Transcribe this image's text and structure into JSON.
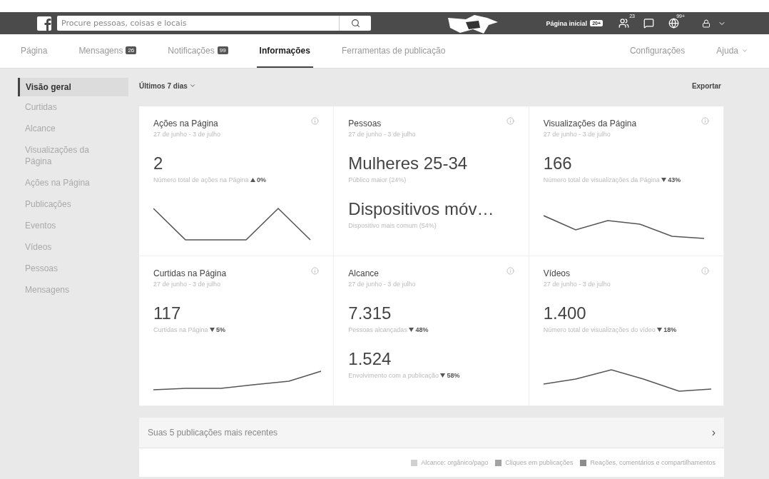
{
  "top_bar": {
    "search": {
      "placeholder": "Procure pessoas, coisas e locais"
    },
    "home": {
      "label": "Página inicial",
      "badge": "20+"
    },
    "friends_badge": "23",
    "globe_badge": "99+"
  },
  "tabs": [
    {
      "label": "Página",
      "selected": false
    },
    {
      "label": "Mensagens",
      "badge": "26",
      "selected": false
    },
    {
      "label": "Notificações",
      "badge": "99",
      "selected": false
    },
    {
      "label": "Informações",
      "selected": true
    },
    {
      "label": "Ferramentas de publicação",
      "selected": false
    }
  ],
  "right_tabs": [
    {
      "label": "Configurações"
    },
    {
      "label": "Ajuda",
      "dropdown": true
    }
  ],
  "sidebar": {
    "items": [
      {
        "label": "Visão geral",
        "selected": true
      },
      {
        "label": "Curtidas",
        "selected": false
      },
      {
        "label": "Alcance",
        "selected": false
      },
      {
        "label": "Visualizações da Página",
        "selected": false
      },
      {
        "label": "Ações na Página",
        "selected": false
      },
      {
        "label": "Publicações",
        "selected": false
      },
      {
        "label": "Eventos",
        "selected": false
      },
      {
        "label": "Vídeos",
        "selected": false
      },
      {
        "label": "Pessoas",
        "selected": false
      },
      {
        "label": "Mensagens",
        "selected": false
      }
    ]
  },
  "period": "Últimos 7 dias",
  "export": "Exportar",
  "cards": [
    {
      "title": "Ações na Página",
      "date": "27 de junho - 3 de julho",
      "sparkline": true,
      "stats": [
        {
          "value": "2",
          "caption": "Número total de ações na Página",
          "rising": true,
          "change": "0%"
        }
      ]
    },
    {
      "title": "Pessoas",
      "date": "27 de junho - 3 de julho",
      "stats": [
        {
          "value": "Mulheres 25-34",
          "caption": "Público maior (24%)"
        },
        {
          "value": "Dispositivos móv…",
          "caption": "Dispositivo mais comum (54%)"
        }
      ]
    },
    {
      "title": "Visualizações da Página",
      "date": "27 de junho - 3 de julho",
      "sparkline": true,
      "stats": [
        {
          "value": "166",
          "caption": "Número total de visualizações da Página",
          "rising": false,
          "change": "43%"
        }
      ]
    },
    {
      "title": "Curtidas na Página",
      "date": "27 de junho - 3 de julho",
      "sparkline": true,
      "stats": [
        {
          "value": "117",
          "caption": "Curtidas na Página",
          "rising": false,
          "change": "5%"
        }
      ]
    },
    {
      "title": "Alcance",
      "date": "27 de junho - 3 de julho",
      "stats": [
        {
          "value": "7.315",
          "caption": "Pessoas alcançadas",
          "rising": false,
          "change": "48%"
        },
        {
          "value": "1.524",
          "caption": "Envolvimento com a publicação",
          "rising": false,
          "change": "58%"
        }
      ]
    },
    {
      "title": "Vídeos",
      "date": "27 de junho - 3 de julho",
      "sparkline": true,
      "stats": [
        {
          "value": "1.400",
          "caption": "Número total de visualizações do vídeo",
          "rising": false,
          "change": "18%"
        }
      ]
    }
  ],
  "recent_posts": {
    "title": "Suas 5 publicações mais recentes",
    "arrow": "›"
  },
  "legend": [
    {
      "label": "Alcance: orgânico/pago",
      "color": "#d0d0d0"
    },
    {
      "label": "Cliques em publicações",
      "color": "#a3a3a3"
    },
    {
      "label": "Reações, comentários e compartilhamentos",
      "color": "#8c8c8c"
    }
  ]
}
